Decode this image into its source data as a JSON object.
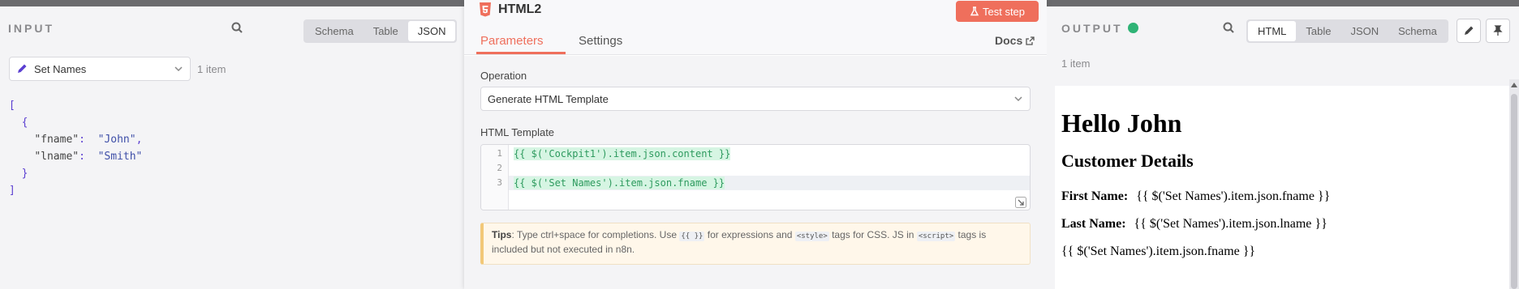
{
  "input": {
    "title": "INPUT",
    "view_options": [
      "Schema",
      "Table",
      "JSON"
    ],
    "active_view": "JSON",
    "node_select": "Set Names",
    "items_count": "1 item",
    "json_lines": [
      {
        "indent": "",
        "text": "["
      },
      {
        "indent": "  ",
        "text": "{"
      },
      {
        "indent": "    ",
        "key": "\"fname\"",
        "value": "\"John\"",
        "comma": ","
      },
      {
        "indent": "    ",
        "key": "\"lname\"",
        "value": "\"Smith\"",
        "comma": ""
      },
      {
        "indent": "  ",
        "text": "}"
      },
      {
        "indent": "",
        "text": "]"
      }
    ]
  },
  "node": {
    "title": "HTML2",
    "test_button": "Test step",
    "tabs": [
      "Parameters",
      "Settings"
    ],
    "active_tab": "Parameters",
    "docs_label": "Docs",
    "operation_label": "Operation",
    "operation_value": "Generate HTML Template",
    "template_label": "HTML Template",
    "code_lines": [
      {
        "num": "1",
        "text": "{{ $('Cockpit1').item.json.content }}"
      },
      {
        "num": "2",
        "text": ""
      },
      {
        "num": "3",
        "text": "{{ $('Set Names').item.json.fname }}"
      }
    ],
    "tips": {
      "bold": "Tips",
      "part1": ": Type ctrl+space for completions. Use ",
      "chip1": "{{ }}",
      "part2": " for expressions and ",
      "chip2": "<style>",
      "part3": " tags for CSS. JS in ",
      "chip3": "<script>",
      "part4": " tags is included but not executed in n8n."
    }
  },
  "output": {
    "title": "OUTPUT",
    "view_options": [
      "HTML",
      "Table",
      "JSON",
      "Schema"
    ],
    "active_view": "HTML",
    "items_count": "1 item",
    "rendered": {
      "h1": "Hello John",
      "h2": "Customer Details",
      "first_label": "First Name:",
      "first_value": "{{ $('Set Names').item.json.fname }}",
      "last_label": "Last Name:",
      "last_value": "{{ $('Set Names').item.json.lname }}",
      "plain": "{{ $('Set Names').item.json.fname }}"
    }
  },
  "colors": {
    "accent": "#ef6f5c",
    "success": "#2fb376",
    "expression_bg": "#d6f5e3"
  }
}
